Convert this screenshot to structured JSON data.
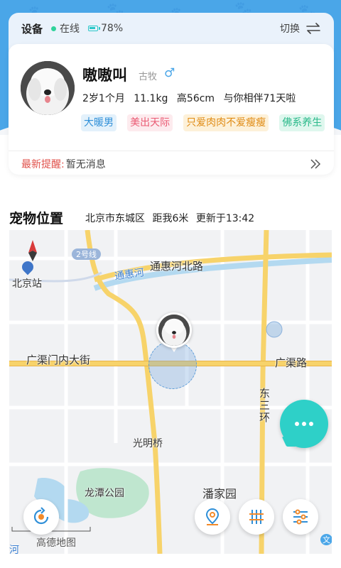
{
  "device": {
    "title": "设备",
    "status": "在线",
    "battery": "78%",
    "battery_level": 0.78,
    "switch_label": "切换"
  },
  "pet": {
    "name": "嗷嗷叫",
    "breed": "古牧",
    "gender": "♂",
    "stats": [
      "2岁1个月",
      "11.1kg",
      "高56cm",
      "与你相伴71天啦"
    ],
    "tags": [
      "大暖男",
      "美出天际",
      "只爱肉肉不爱瘦瘦",
      "佛系养生"
    ]
  },
  "reminder": {
    "label": "最新提醒:",
    "text": "暂无消息"
  },
  "location_section": {
    "title": "宠物位置",
    "district": "北京市东城区",
    "distance": "距我6米",
    "updated": "更新于13:42"
  },
  "map": {
    "labels": {
      "beijing_station": "北京站",
      "metro_line": "2号线",
      "tonghui_river": "通惠河",
      "tonghuihe_north_rd": "通惠河北路",
      "guangqumen_inner_st": "广渠门内大街",
      "guangqu_rd": "广渠路",
      "east_third_ring": "东三环",
      "guangming_bridge": "光明桥",
      "longtan_park": "龙潭公园",
      "panjiayuan": "潘家园",
      "river_partial": "河",
      "brand": "高德地图",
      "partial_text": "文"
    }
  },
  "colors": {
    "accent_blue": "#4aa6e8",
    "chat_teal": "#2ed0c8",
    "reminder_red": "#e0504a",
    "road_yellow": "#f7d36a"
  }
}
